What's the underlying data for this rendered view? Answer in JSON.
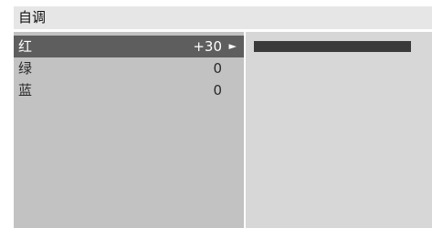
{
  "menu": {
    "title": "自调",
    "items": [
      {
        "label": "红",
        "value": "+30",
        "arrow": "►",
        "selected": true
      },
      {
        "label": "绿",
        "value": "0",
        "selected": false
      },
      {
        "label": "蓝",
        "value": "0",
        "selected": false
      }
    ]
  },
  "slider": {
    "level_fraction": 1.0,
    "fill_color": "#3a3a3a",
    "track_color": "#d7d7d7"
  },
  "colors": {
    "header_bg": "#e6e6e6",
    "left_panel_bg": "#c2c2c2",
    "right_panel_bg": "#d7d7d7",
    "selected_row_bg": "#5e5e5e"
  }
}
